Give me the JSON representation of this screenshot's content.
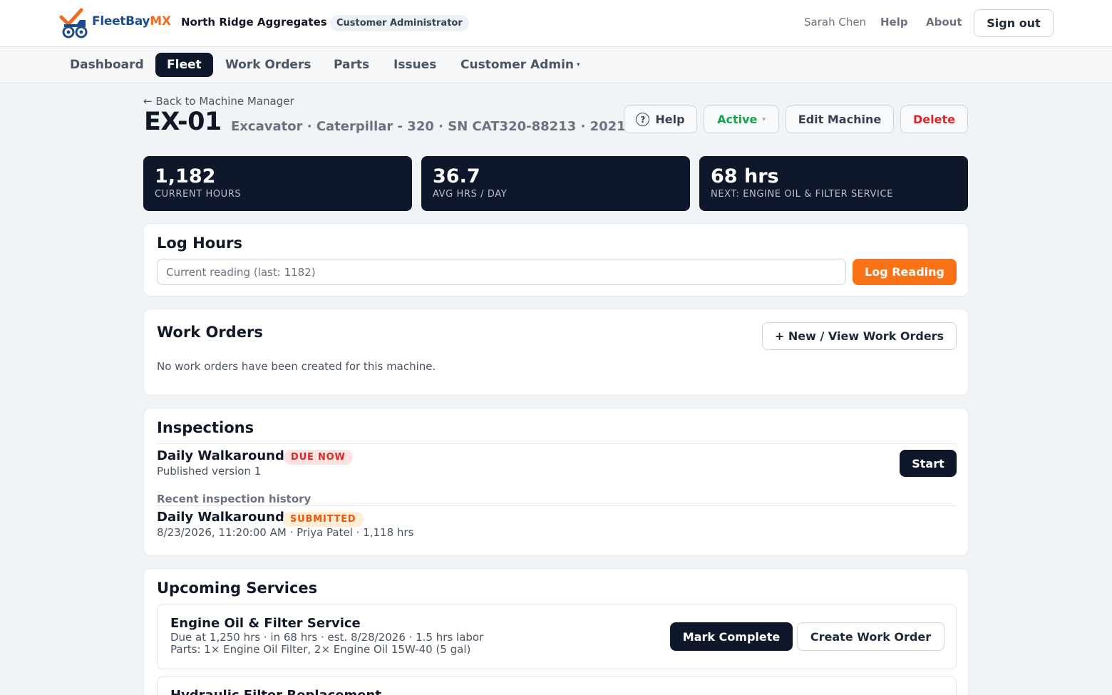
{
  "app": {
    "brand_main": "FleetBay",
    "brand_accent": "MX",
    "organization": "North Ridge Aggregates",
    "role": "Customer Administrator",
    "user_name": "Sarah Chen",
    "help_label": "Help",
    "about_label": "About",
    "signout_label": "Sign out"
  },
  "nav": {
    "items": [
      {
        "label": "Dashboard"
      },
      {
        "label": "Fleet",
        "active": true
      },
      {
        "label": "Work Orders"
      },
      {
        "label": "Parts"
      },
      {
        "label": "Issues"
      },
      {
        "label": "Customer Admin"
      }
    ],
    "dropdown_caret": "▾"
  },
  "machine": {
    "back_link": "← Back to Machine Manager",
    "id": "EX-01",
    "subtitle": "Excavator · Caterpillar - 320 · SN CAT320-88213 · 2021",
    "help_label": "Help",
    "status_label": "Active",
    "status_caret": "▾",
    "edit_label": "Edit Machine",
    "delete_label": "Delete"
  },
  "stats": [
    {
      "value": "1,182",
      "label": "Current Hours"
    },
    {
      "value": "36.7",
      "label": "Avg Hrs / Day"
    },
    {
      "value": "68 hrs",
      "label": "Next: Engine Oil & Filter Service"
    }
  ],
  "log_hours": {
    "title": "Log Hours",
    "placeholder": "Current reading (last: 1182)",
    "button_label": "Log Reading"
  },
  "work_orders": {
    "title": "Work Orders",
    "button_label": "+ New / View Work Orders",
    "empty_text": "No work orders have been created for this machine."
  },
  "inspections": {
    "title": "Inspections",
    "due": {
      "name": "Daily Walkaround",
      "badge": "DUE NOW",
      "version": "Published version 1",
      "start_label": "Start"
    },
    "history_heading": "Recent inspection history",
    "history": [
      {
        "name": "Daily Walkaround",
        "badge": "SUBMITTED",
        "details": "8/23/2026, 11:20:00 AM · Priya Patel · 1,118 hrs"
      }
    ]
  },
  "services": {
    "title": "Upcoming Services",
    "items": [
      {
        "name": "Engine Oil & Filter Service",
        "due_line": "Due at 1,250 hrs · in 68 hrs · est. 8/28/2026 · 1.5 hrs labor",
        "parts_line": "Parts: 1× Engine Oil Filter, 2× Engine Oil 15W-40 (5 gal)",
        "complete_label": "Mark Complete",
        "create_label": "Create Work Order"
      },
      {
        "name": "Hydraulic Filter Replacement"
      }
    ]
  },
  "colors": {
    "brand_blue": "#1e4c8a",
    "brand_orange": "#f36b1c",
    "dark": "#0f172a",
    "active_green": "#16a34a",
    "danger_red": "#dc2626",
    "cta_orange": "#f97316"
  }
}
